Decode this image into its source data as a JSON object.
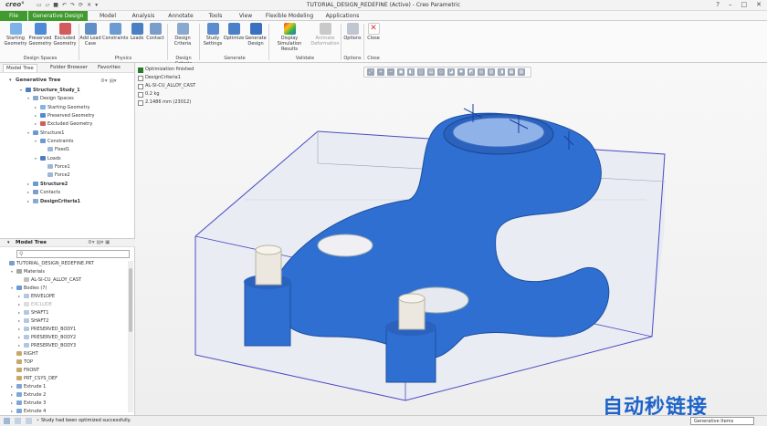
{
  "app": {
    "logo": "creo°",
    "window_title": "TUTORIAL_DESIGN_REDEFINE (Active) - Creo Parametric",
    "window_controls": [
      "?",
      "–",
      "□",
      "✕"
    ]
  },
  "tabs": [
    "File",
    "Generative Design",
    "Model",
    "Analysis",
    "Annotate",
    "Tools",
    "View",
    "Flexible Modeling",
    "Applications"
  ],
  "ribbon": {
    "buttons": [
      {
        "label": "Starting\nGeometry",
        "icon": "starting-geometry-icon"
      },
      {
        "label": "Preserved\nGeometry",
        "icon": "preserved-geometry-icon"
      },
      {
        "label": "Excluded\nGeometry",
        "icon": "excluded-geometry-icon"
      },
      {
        "label": "Add Load\nCase",
        "icon": "add-load-case-icon"
      },
      {
        "label": "Constraints",
        "icon": "constraints-icon"
      },
      {
        "label": "Loads",
        "icon": "loads-icon"
      },
      {
        "label": "Contact",
        "icon": "contact-icon"
      },
      {
        "label": "Design\nCriteria",
        "icon": "design-criteria-icon"
      },
      {
        "label": "Study\nSettings",
        "icon": "study-settings-icon"
      },
      {
        "label": "Optimize",
        "icon": "optimize-icon"
      },
      {
        "label": "Generate\nDesign",
        "icon": "generate-design-icon"
      },
      {
        "label": "Display\nSimulation Results",
        "icon": "display-results-icon"
      },
      {
        "label": "Animate\nDeformation",
        "icon": "animate-deformation-icon"
      },
      {
        "label": "Options",
        "icon": "options-icon"
      },
      {
        "label": "Close",
        "icon": "close-icon"
      }
    ],
    "groups": [
      "Design Spaces",
      "Physics",
      "Design Criteria",
      "Generate",
      "Validate",
      "Options",
      "Close"
    ]
  },
  "left_panel": {
    "tabs": [
      "Model Tree",
      "Folder Browser",
      "Favorites"
    ],
    "generative_tree": {
      "header": "Generative Tree",
      "items": [
        "Structure_Study_1",
        "Design Spaces",
        "Starting Geometry",
        "Preserved Geometry",
        "Excluded Geometry",
        "Structure1",
        "Constraints",
        "Fixed1",
        "Loads",
        "Force1",
        "Force2",
        "Structure2",
        "Contacts",
        "DesignCriteria1"
      ]
    },
    "model_tree": {
      "header": "Model Tree",
      "items": [
        "TUTORIAL_DESIGN_REDEFINE.PRT",
        "Materials",
        "AL-SI-CU_ALLOY_CAST",
        "Bodies (7)",
        "ENVELOPE",
        "EXCLUDE",
        "SHAFT1",
        "SHAFT2",
        "PRESERVED_BODY1",
        "PRESERVED_BODY2",
        "PRESERVED_BODY3",
        "RIGHT",
        "TOP",
        "FRONT",
        "PRT_CSYS_DEF",
        "Extrude 1",
        "Extrude 2",
        "Extrude 3",
        "Extrude 4"
      ]
    }
  },
  "viewport": {
    "info_lines": [
      "Optimization finished",
      "DesignCriteria1",
      "AL-SI-CU_ALLOY_CAST",
      "0.2 kg",
      "2.1486 mm (23012)"
    ]
  },
  "status": {
    "message": "Study had been optimized successfully.",
    "filter": "Generative Items"
  },
  "watermark": "自动秒链接",
  "colors": {
    "accent": "#3f9b2d",
    "part": "#2f6fd1",
    "shaft": "#ece8df"
  }
}
